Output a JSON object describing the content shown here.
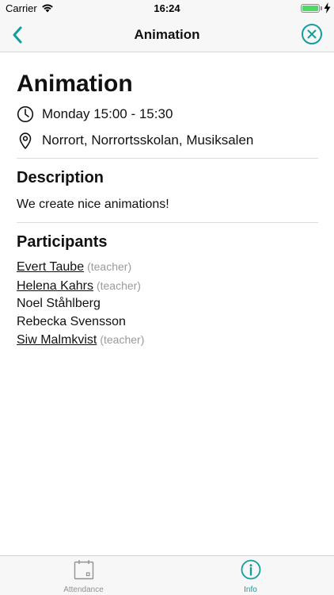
{
  "status_bar": {
    "carrier": "Carrier",
    "time": "16:24"
  },
  "nav": {
    "title": "Animation",
    "back_icon": "chevron-left-icon",
    "close_icon": "close-circle-icon"
  },
  "event": {
    "title": "Animation",
    "time": "Monday 15:00 - 15:30",
    "location": "Norrort, Norrortsskolan, Musiksalen"
  },
  "description": {
    "heading": "Description",
    "text": "We create nice animations!"
  },
  "participants": {
    "heading": "Participants",
    "items": [
      {
        "name": "Evert Taube",
        "role": "(teacher)"
      },
      {
        "name": "Helena Kahrs",
        "role": "(teacher)"
      },
      {
        "name": "Noel Ståhlberg",
        "role": ""
      },
      {
        "name": "Rebecka Svensson",
        "role": ""
      },
      {
        "name": "Siw Malmkvist",
        "role": "(teacher)"
      }
    ]
  },
  "tabs": [
    {
      "label": "Attendance",
      "icon": "calendar-icon",
      "active": false
    },
    {
      "label": "Info",
      "icon": "info-circle-icon",
      "active": true
    }
  ],
  "colors": {
    "accent": "#119e9e",
    "battery": "#4cd964",
    "muted": "#9a9a9a"
  }
}
